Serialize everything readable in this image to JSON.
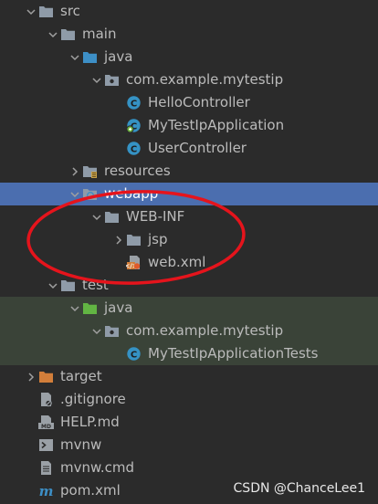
{
  "tree": [
    {
      "label": "src",
      "depth": 0,
      "chevron": "down",
      "icon": "folder-icon"
    },
    {
      "label": "main",
      "depth": 1,
      "chevron": "down",
      "icon": "folder-icon"
    },
    {
      "label": "java",
      "depth": 2,
      "chevron": "down",
      "icon": "source-folder-icon"
    },
    {
      "label": "com.example.mytestip",
      "depth": 3,
      "chevron": "down",
      "icon": "package-icon"
    },
    {
      "label": "HelloController",
      "depth": 4,
      "chevron": "none",
      "icon": "java-class-icon"
    },
    {
      "label": "MyTestIpApplication",
      "depth": 4,
      "chevron": "none",
      "icon": "spring-boot-class-icon"
    },
    {
      "label": "UserController",
      "depth": 4,
      "chevron": "none",
      "icon": "java-class-icon"
    },
    {
      "label": "resources",
      "depth": 2,
      "chevron": "right",
      "icon": "resources-folder-icon"
    },
    {
      "label": "webapp",
      "depth": 2,
      "chevron": "down",
      "icon": "web-folder-icon",
      "selected": true
    },
    {
      "label": "WEB-INF",
      "depth": 3,
      "chevron": "down",
      "icon": "folder-icon"
    },
    {
      "label": "jsp",
      "depth": 4,
      "chevron": "right",
      "icon": "folder-icon"
    },
    {
      "label": "web.xml",
      "depth": 4,
      "chevron": "none",
      "icon": "xml-file-icon"
    },
    {
      "label": "test",
      "depth": 1,
      "chevron": "down",
      "icon": "folder-icon"
    },
    {
      "label": "java",
      "depth": 2,
      "chevron": "down",
      "icon": "test-source-folder-icon",
      "test": true
    },
    {
      "label": "com.example.mytestip",
      "depth": 3,
      "chevron": "down",
      "icon": "package-icon",
      "test": true
    },
    {
      "label": "MyTestIpApplicationTests",
      "depth": 4,
      "chevron": "none",
      "icon": "java-class-icon",
      "test": true
    },
    {
      "label": "target",
      "depth": 0,
      "chevron": "right",
      "icon": "excluded-folder-icon"
    },
    {
      "label": ".gitignore",
      "depth": 0,
      "chevron": "none",
      "icon": "gitignore-file-icon"
    },
    {
      "label": "HELP.md",
      "depth": 0,
      "chevron": "none",
      "icon": "markdown-file-icon"
    },
    {
      "label": "mvnw",
      "depth": 0,
      "chevron": "none",
      "icon": "shell-script-icon"
    },
    {
      "label": "mvnw.cmd",
      "depth": 0,
      "chevron": "none",
      "icon": "text-file-icon"
    },
    {
      "label": "pom.xml",
      "depth": 0,
      "chevron": "none",
      "icon": "maven-pom-icon"
    }
  ],
  "watermark": "CSDN @ChanceLee1",
  "colors": {
    "background": "#2b2b2b",
    "selection": "#4b6eaf",
    "test_row": "#3a4338",
    "folder": "#8f9ba8",
    "source_folder": "#3d8fc6",
    "test_folder": "#62b543",
    "excluded_folder": "#d27e3a",
    "class_icon": "#3592c4",
    "annotation": "#e5141c"
  }
}
